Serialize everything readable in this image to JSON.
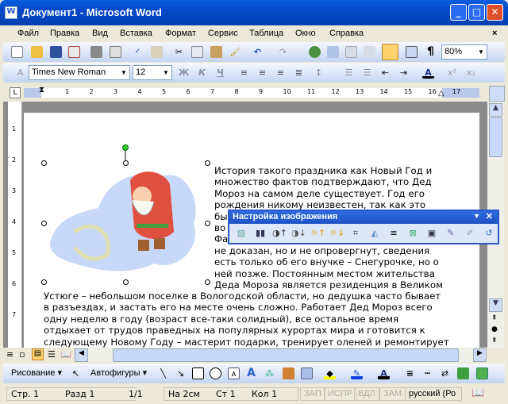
{
  "window": {
    "title": "Документ1 - Microsoft Word",
    "minimize": "_",
    "maximize": "□",
    "close": "✕"
  },
  "menu": [
    "Файл",
    "Правка",
    "Вид",
    "Вставка",
    "Формат",
    "Сервис",
    "Таблица",
    "Окно",
    "Справка"
  ],
  "menu_close": "×",
  "standard": {
    "zoom": "80%"
  },
  "formatting": {
    "font": "Times New Roman",
    "size": "12",
    "bold": "Ж",
    "italic": "К",
    "underline": "Ч"
  },
  "ruler": {
    "marks": [
      "1",
      "2",
      "3",
      "4",
      "5",
      "6",
      "7",
      "8",
      "9",
      "10",
      "11",
      "12",
      "13",
      "14",
      "15",
      "16",
      "17"
    ]
  },
  "vruler": [
    "1",
    "2",
    "3",
    "4",
    "5",
    "6",
    "7"
  ],
  "document": {
    "wrapped_lines": [
      "История такого праздника как Новый Год и",
      "множество фактов подтверждают, что Дед",
      "Мороз на самом деле существует. Год его",
      "рождения никому неизвестен, так как это",
      "бы",
      "во",
      "Фа",
      "не доказан, но и не опровергнут, сведения",
      "есть только об его внучке – Снегурочке, но о",
      "ней позже. Постоянным местом жительства",
      "Деда Мороза является резиденция в Великом"
    ],
    "full_lines": [
      "Устюге – небольшом поселке в Вологодской области, но дедушка часто бывает",
      "в разъездах, и застать его на месте очень сложно. Работает Дед Мороз всего",
      "одну неделю в году (возраст все-таки солидный), все остальное время",
      "отдыхает от трудов праведных на популярных курортах мира и готовится к",
      "следующему Новому Году – мастерит подарки, тренирует оленей и ремонтирует"
    ]
  },
  "picture_toolbar": {
    "title": "Настройка изображения"
  },
  "drawing": {
    "draw": "Рисование",
    "autoshapes": "Автофигуры"
  },
  "status": {
    "page": "Стр. 1",
    "section": "Разд 1",
    "pages": "1/1",
    "at": "На 2см",
    "line": "Ст 1",
    "col": "Кол 1",
    "rec": "ЗАП",
    "trk": "ИСПР",
    "ext": "ВДЛ",
    "ovr": "ЗАМ",
    "lang": "русский (Ро"
  },
  "colors": {
    "title_bar": "#0548c8",
    "toolbar": "#c3d4f0",
    "highlight": "#ffd36b"
  }
}
